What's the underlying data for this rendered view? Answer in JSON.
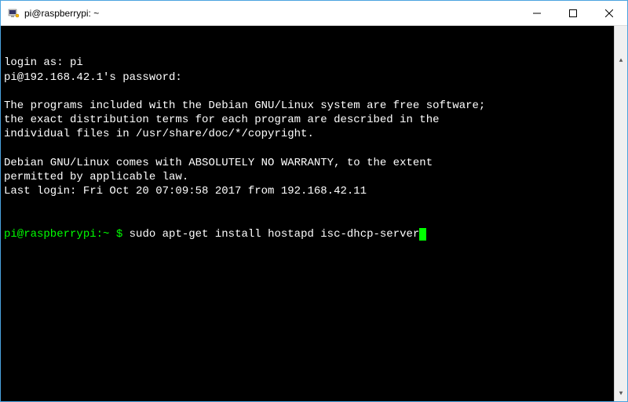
{
  "window": {
    "title": "pi@raspberrypi: ~"
  },
  "terminal": {
    "lines": [
      "login as: pi",
      "pi@192.168.42.1's password:",
      "",
      "The programs included with the Debian GNU/Linux system are free software;",
      "the exact distribution terms for each program are described in the",
      "individual files in /usr/share/doc/*/copyright.",
      "",
      "Debian GNU/Linux comes with ABSOLUTELY NO WARRANTY, to the extent",
      "permitted by applicable law.",
      "Last login: Fri Oct 20 07:09:58 2017 from 192.168.42.11"
    ],
    "prompt": "pi@raspberrypi:~ $ ",
    "command": "sudo apt-get install hostapd isc-dhcp-server"
  }
}
